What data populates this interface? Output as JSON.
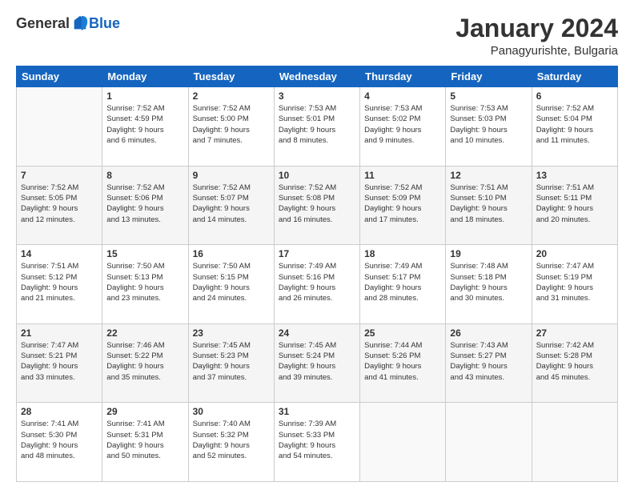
{
  "logo": {
    "general": "General",
    "blue": "Blue"
  },
  "header": {
    "month": "January 2024",
    "location": "Panagyurishte, Bulgaria"
  },
  "weekdays": [
    "Sunday",
    "Monday",
    "Tuesday",
    "Wednesday",
    "Thursday",
    "Friday",
    "Saturday"
  ],
  "weeks": [
    [
      {
        "day": "",
        "info": ""
      },
      {
        "day": "1",
        "info": "Sunrise: 7:52 AM\nSunset: 4:59 PM\nDaylight: 9 hours\nand 6 minutes."
      },
      {
        "day": "2",
        "info": "Sunrise: 7:52 AM\nSunset: 5:00 PM\nDaylight: 9 hours\nand 7 minutes."
      },
      {
        "day": "3",
        "info": "Sunrise: 7:53 AM\nSunset: 5:01 PM\nDaylight: 9 hours\nand 8 minutes."
      },
      {
        "day": "4",
        "info": "Sunrise: 7:53 AM\nSunset: 5:02 PM\nDaylight: 9 hours\nand 9 minutes."
      },
      {
        "day": "5",
        "info": "Sunrise: 7:53 AM\nSunset: 5:03 PM\nDaylight: 9 hours\nand 10 minutes."
      },
      {
        "day": "6",
        "info": "Sunrise: 7:52 AM\nSunset: 5:04 PM\nDaylight: 9 hours\nand 11 minutes."
      }
    ],
    [
      {
        "day": "7",
        "info": "Sunrise: 7:52 AM\nSunset: 5:05 PM\nDaylight: 9 hours\nand 12 minutes."
      },
      {
        "day": "8",
        "info": "Sunrise: 7:52 AM\nSunset: 5:06 PM\nDaylight: 9 hours\nand 13 minutes."
      },
      {
        "day": "9",
        "info": "Sunrise: 7:52 AM\nSunset: 5:07 PM\nDaylight: 9 hours\nand 14 minutes."
      },
      {
        "day": "10",
        "info": "Sunrise: 7:52 AM\nSunset: 5:08 PM\nDaylight: 9 hours\nand 16 minutes."
      },
      {
        "day": "11",
        "info": "Sunrise: 7:52 AM\nSunset: 5:09 PM\nDaylight: 9 hours\nand 17 minutes."
      },
      {
        "day": "12",
        "info": "Sunrise: 7:51 AM\nSunset: 5:10 PM\nDaylight: 9 hours\nand 18 minutes."
      },
      {
        "day": "13",
        "info": "Sunrise: 7:51 AM\nSunset: 5:11 PM\nDaylight: 9 hours\nand 20 minutes."
      }
    ],
    [
      {
        "day": "14",
        "info": "Sunrise: 7:51 AM\nSunset: 5:12 PM\nDaylight: 9 hours\nand 21 minutes."
      },
      {
        "day": "15",
        "info": "Sunrise: 7:50 AM\nSunset: 5:13 PM\nDaylight: 9 hours\nand 23 minutes."
      },
      {
        "day": "16",
        "info": "Sunrise: 7:50 AM\nSunset: 5:15 PM\nDaylight: 9 hours\nand 24 minutes."
      },
      {
        "day": "17",
        "info": "Sunrise: 7:49 AM\nSunset: 5:16 PM\nDaylight: 9 hours\nand 26 minutes."
      },
      {
        "day": "18",
        "info": "Sunrise: 7:49 AM\nSunset: 5:17 PM\nDaylight: 9 hours\nand 28 minutes."
      },
      {
        "day": "19",
        "info": "Sunrise: 7:48 AM\nSunset: 5:18 PM\nDaylight: 9 hours\nand 30 minutes."
      },
      {
        "day": "20",
        "info": "Sunrise: 7:47 AM\nSunset: 5:19 PM\nDaylight: 9 hours\nand 31 minutes."
      }
    ],
    [
      {
        "day": "21",
        "info": "Sunrise: 7:47 AM\nSunset: 5:21 PM\nDaylight: 9 hours\nand 33 minutes."
      },
      {
        "day": "22",
        "info": "Sunrise: 7:46 AM\nSunset: 5:22 PM\nDaylight: 9 hours\nand 35 minutes."
      },
      {
        "day": "23",
        "info": "Sunrise: 7:45 AM\nSunset: 5:23 PM\nDaylight: 9 hours\nand 37 minutes."
      },
      {
        "day": "24",
        "info": "Sunrise: 7:45 AM\nSunset: 5:24 PM\nDaylight: 9 hours\nand 39 minutes."
      },
      {
        "day": "25",
        "info": "Sunrise: 7:44 AM\nSunset: 5:26 PM\nDaylight: 9 hours\nand 41 minutes."
      },
      {
        "day": "26",
        "info": "Sunrise: 7:43 AM\nSunset: 5:27 PM\nDaylight: 9 hours\nand 43 minutes."
      },
      {
        "day": "27",
        "info": "Sunrise: 7:42 AM\nSunset: 5:28 PM\nDaylight: 9 hours\nand 45 minutes."
      }
    ],
    [
      {
        "day": "28",
        "info": "Sunrise: 7:41 AM\nSunset: 5:30 PM\nDaylight: 9 hours\nand 48 minutes."
      },
      {
        "day": "29",
        "info": "Sunrise: 7:41 AM\nSunset: 5:31 PM\nDaylight: 9 hours\nand 50 minutes."
      },
      {
        "day": "30",
        "info": "Sunrise: 7:40 AM\nSunset: 5:32 PM\nDaylight: 9 hours\nand 52 minutes."
      },
      {
        "day": "31",
        "info": "Sunrise: 7:39 AM\nSunset: 5:33 PM\nDaylight: 9 hours\nand 54 minutes."
      },
      {
        "day": "",
        "info": ""
      },
      {
        "day": "",
        "info": ""
      },
      {
        "day": "",
        "info": ""
      }
    ]
  ]
}
